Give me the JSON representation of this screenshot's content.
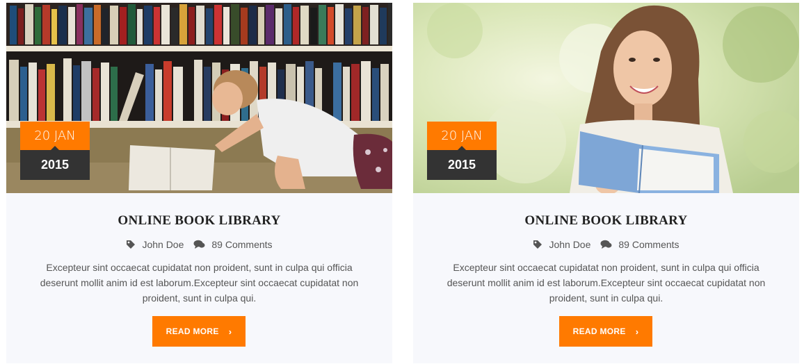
{
  "posts": [
    {
      "image": "woman-reading-book-on-library-floor",
      "date": {
        "day_month": "20 JAN",
        "year": "2015"
      },
      "title": "ONLINE BOOK LIBRARY",
      "author": "John Doe",
      "comments": "89 Comments",
      "excerpt": "Excepteur sint occaecat cupidatat non proident, sunt in culpa qui officia deserunt mollit anim id est laborum.Excepteur sint occaecat cupidatat non proident, sunt in culpa qui.",
      "button_label": "READ MORE"
    },
    {
      "image": "smiling-woman-holding-open-book-outdoors",
      "date": {
        "day_month": "20 JAN",
        "year": "2015"
      },
      "title": "ONLINE BOOK LIBRARY",
      "author": "John Doe",
      "comments": "89 Comments",
      "excerpt": "Excepteur sint occaecat cupidatat non proident, sunt in culpa qui officia deserunt mollit anim id est laborum.Excepteur sint occaecat cupidatat non proident, sunt in culpa qui.",
      "button_label": "READ MORE"
    }
  ],
  "colors": {
    "accent": "#ff7a00",
    "badge_dark": "#333333",
    "card_bg": "#f7f8fc",
    "title_text": "#222222",
    "body_text": "#555555"
  },
  "icons": {
    "author": "tag-icon",
    "comments": "comments-icon",
    "button": "chevron-right-icon"
  }
}
